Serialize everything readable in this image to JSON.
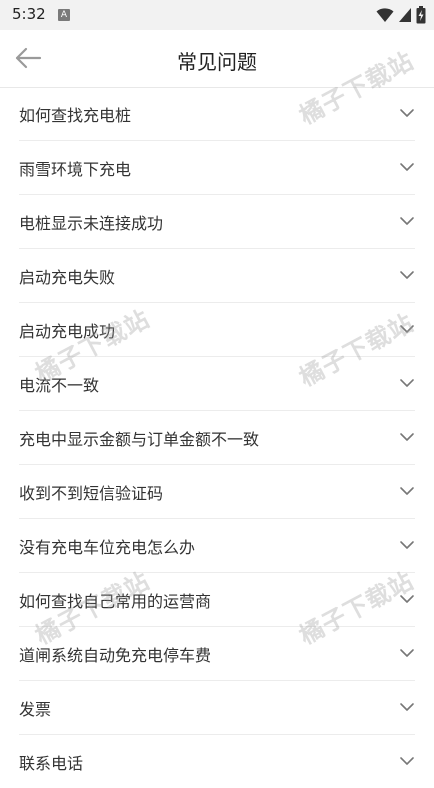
{
  "status_bar": {
    "time": "5:32",
    "app_icon_letter": "A"
  },
  "header": {
    "title": "常见问题"
  },
  "faq": {
    "items": [
      {
        "label": "如何查找充电桩"
      },
      {
        "label": "雨雪环境下充电"
      },
      {
        "label": "电桩显示未连接成功"
      },
      {
        "label": "启动充电失败"
      },
      {
        "label": "启动充电成功"
      },
      {
        "label": "电流不一致"
      },
      {
        "label": "充电中显示金额与订单金额不一致"
      },
      {
        "label": "收到不到短信验证码"
      },
      {
        "label": "没有充电车位充电怎么办"
      },
      {
        "label": "如何查找自己常用的运营商"
      },
      {
        "label": "道闸系统自动免充电停车费"
      },
      {
        "label": "发票"
      },
      {
        "label": "联系电话"
      }
    ]
  },
  "watermark": {
    "text": "橘子下载站"
  },
  "colors": {
    "status_bar_bg": "#f2f2f2",
    "text": "#333333",
    "divider": "#ececec",
    "chevron": "#777777"
  }
}
